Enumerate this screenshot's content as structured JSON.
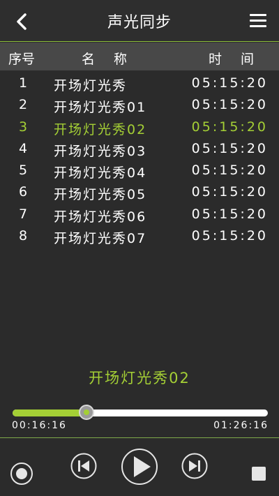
{
  "header": {
    "title": "声光同步",
    "back_icon": "chevron-left-icon",
    "menu_icon": "hamburger-menu-icon"
  },
  "columns": {
    "index": "序号",
    "name": "名　称",
    "time": "时　间"
  },
  "tracks": [
    {
      "index": "1",
      "name": "开场灯光秀",
      "time": "05:15:20",
      "active": false
    },
    {
      "index": "2",
      "name": "开场灯光秀01",
      "time": "05:15:20",
      "active": false
    },
    {
      "index": "3",
      "name": "开场灯光秀02",
      "time": "05:15:20",
      "active": true
    },
    {
      "index": "4",
      "name": "开场灯光秀03",
      "time": "05:15:20",
      "active": false
    },
    {
      "index": "5",
      "name": "开场灯光秀04",
      "time": "05:15:20",
      "active": false
    },
    {
      "index": "6",
      "name": "开场灯光秀05",
      "time": "05:15:20",
      "active": false
    },
    {
      "index": "7",
      "name": "开场灯光秀06",
      "time": "05:15:20",
      "active": false
    },
    {
      "index": "8",
      "name": "开场灯光秀07",
      "time": "05:15:20",
      "active": false
    }
  ],
  "player": {
    "now_playing": "开场灯光秀02",
    "current_time": "00:16:16",
    "total_time": "01:26:16",
    "progress_fraction": 0.29
  },
  "colors": {
    "accent": "#a4cf35",
    "background": "#2b2b2b",
    "header_bar": "#484848"
  },
  "controls": [
    "record-icon",
    "previous-track-icon",
    "play-icon",
    "next-track-icon",
    "stop-icon"
  ]
}
